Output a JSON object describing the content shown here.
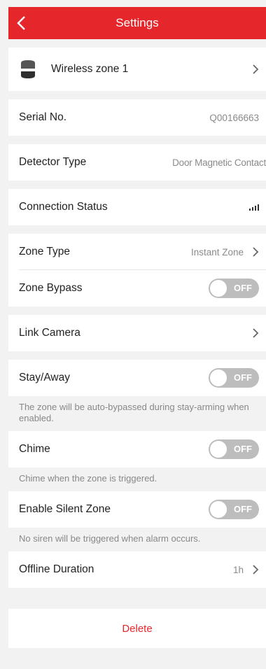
{
  "header": {
    "title": "Settings"
  },
  "device": {
    "name": "Wireless zone 1"
  },
  "serial": {
    "label": "Serial No.",
    "value": "Q00166663"
  },
  "detector": {
    "label": "Detector Type",
    "value": "Door Magnetic Contact"
  },
  "connection": {
    "label": "Connection Status"
  },
  "zone_type": {
    "label": "Zone Type",
    "value": "Instant Zone"
  },
  "zone_bypass": {
    "label": "Zone Bypass",
    "state": "OFF"
  },
  "link_camera": {
    "label": "Link Camera"
  },
  "stay_away": {
    "label": "Stay/Away",
    "state": "OFF",
    "note": "The zone will be auto-bypassed during stay-arming when enabled."
  },
  "chime": {
    "label": "Chime",
    "state": "OFF",
    "note": "Chime when the zone is triggered."
  },
  "silent_zone": {
    "label": "Enable Silent Zone",
    "state": "OFF",
    "note": "No siren will be triggered when alarm occurs."
  },
  "offline_duration": {
    "label": "Offline Duration",
    "value": "1h"
  },
  "delete": {
    "label": "Delete"
  },
  "colors": {
    "accent": "#e5262b",
    "background": "#f2f2f2",
    "toggle_off": "#bdbdbd"
  },
  "icons": {
    "back": "back-arrow-icon",
    "device": "detector-device-icon",
    "signal": "signal-strength-icon",
    "chevron": "chevron-right-icon"
  }
}
